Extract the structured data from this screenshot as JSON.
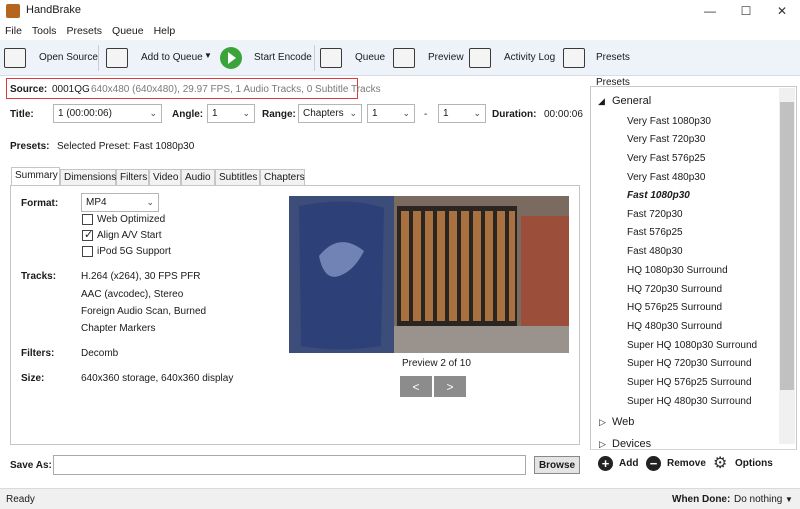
{
  "window": {
    "title": "HandBrake",
    "minimize": "—",
    "maximize": "☐",
    "close": "✕"
  },
  "menu": [
    "File",
    "Tools",
    "Presets",
    "Queue",
    "Help"
  ],
  "toolbar": {
    "open_source": "Open Source",
    "add_to_queue": "Add to Queue",
    "start_encode": "Start Encode",
    "queue": "Queue",
    "preview": "Preview",
    "activity_log": "Activity Log",
    "presets": "Presets"
  },
  "source": {
    "label": "Source:",
    "name": "0001QG",
    "info": "640x480 (640x480), 29.97 FPS, 1 Audio Tracks, 0 Subtitle Tracks"
  },
  "title_row": {
    "title_label": "Title:",
    "title_value": "1 (00:00:06)",
    "angle_label": "Angle:",
    "angle_value": "1",
    "range_label": "Range:",
    "range_value": "Chapters",
    "range_start": "1",
    "range_dash": "-",
    "range_end": "1",
    "duration_label": "Duration:",
    "duration_value": "00:00:06"
  },
  "presets_row": {
    "label": "Presets:",
    "value": "Selected Preset: Fast 1080p30"
  },
  "tabs": [
    "Summary",
    "Dimensions",
    "Filters",
    "Video",
    "Audio",
    "Subtitles",
    "Chapters"
  ],
  "summary": {
    "format_label": "Format:",
    "format_value": "MP4",
    "web_optimized": "Web Optimized",
    "web_optimized_checked": false,
    "align_av": "Align A/V Start",
    "align_av_checked": true,
    "ipod": "iPod 5G Support",
    "ipod_checked": false,
    "tracks_label": "Tracks:",
    "tracks": [
      "H.264 (x264), 30 FPS PFR",
      "AAC (avcodec), Stereo",
      "Foreign Audio Scan, Burned",
      "Chapter Markers"
    ],
    "filters_label": "Filters:",
    "filters_value": "Decomb",
    "size_label": "Size:",
    "size_value": "640x360 storage, 640x360 display",
    "preview_caption": "Preview 2 of 10",
    "prev": "<",
    "next": ">"
  },
  "presets_panel": {
    "header": "Presets",
    "general_group": "General",
    "general_items": [
      "Very Fast 1080p30",
      "Very Fast 720p30",
      "Very Fast 576p25",
      "Very Fast 480p30",
      "Fast 1080p30",
      "Fast 720p30",
      "Fast 576p25",
      "Fast 480p30",
      "HQ 1080p30 Surround",
      "HQ 720p30 Surround",
      "HQ 576p25 Surround",
      "HQ 480p30 Surround",
      "Super HQ 1080p30 Surround",
      "Super HQ 720p30 Surround",
      "Super HQ 576p25 Surround",
      "Super HQ 480p30 Surround"
    ],
    "selected_index": 4,
    "web_group": "Web",
    "devices_group": "Devices",
    "add": "Add",
    "remove": "Remove",
    "options": "Options"
  },
  "save_as": {
    "label": "Save As:",
    "value": "",
    "browse": "Browse"
  },
  "status": {
    "text": "Ready",
    "when_done_label": "When Done:",
    "when_done_value": "Do nothing"
  }
}
